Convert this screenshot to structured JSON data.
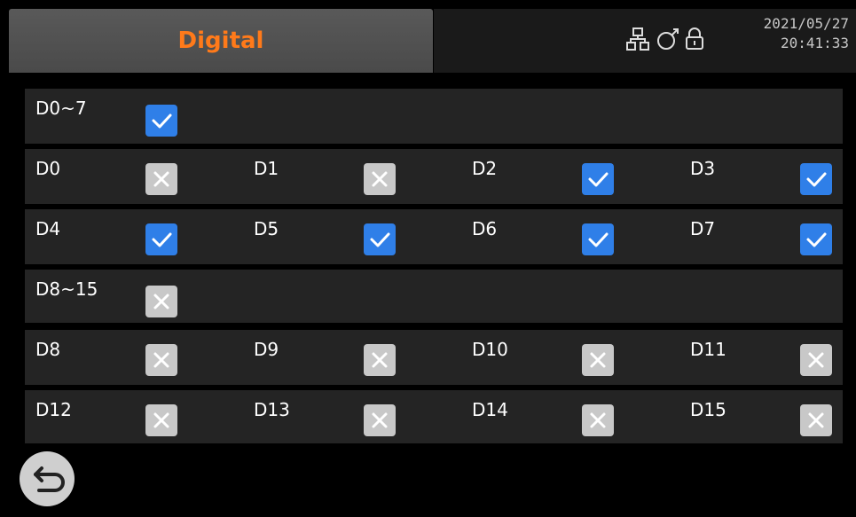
{
  "header": {
    "title": "Digital",
    "date": "2021/05/27",
    "time": "20:41:33",
    "status_icons": [
      "network-icon",
      "probe-icon",
      "lock-icon"
    ]
  },
  "groups": [
    {
      "label": "D0~7",
      "checked": true,
      "channels": [
        {
          "label": "D0",
          "checked": false
        },
        {
          "label": "D1",
          "checked": false
        },
        {
          "label": "D2",
          "checked": true
        },
        {
          "label": "D3",
          "checked": true
        },
        {
          "label": "D4",
          "checked": true
        },
        {
          "label": "D5",
          "checked": true
        },
        {
          "label": "D6",
          "checked": true
        },
        {
          "label": "D7",
          "checked": true
        }
      ]
    },
    {
      "label": "D8~15",
      "checked": false,
      "channels": [
        {
          "label": "D8",
          "checked": false
        },
        {
          "label": "D9",
          "checked": false
        },
        {
          "label": "D10",
          "checked": false
        },
        {
          "label": "D11",
          "checked": false
        },
        {
          "label": "D12",
          "checked": false
        },
        {
          "label": "D13",
          "checked": false
        },
        {
          "label": "D14",
          "checked": false
        },
        {
          "label": "D15",
          "checked": false
        }
      ]
    }
  ],
  "footer": {
    "back_icon": "back-arrow-icon"
  },
  "colors": {
    "title": "#ff7a1a",
    "checked": "#2f7fe8",
    "unchecked": "#c8c8c8",
    "row_bg": "#242424"
  }
}
